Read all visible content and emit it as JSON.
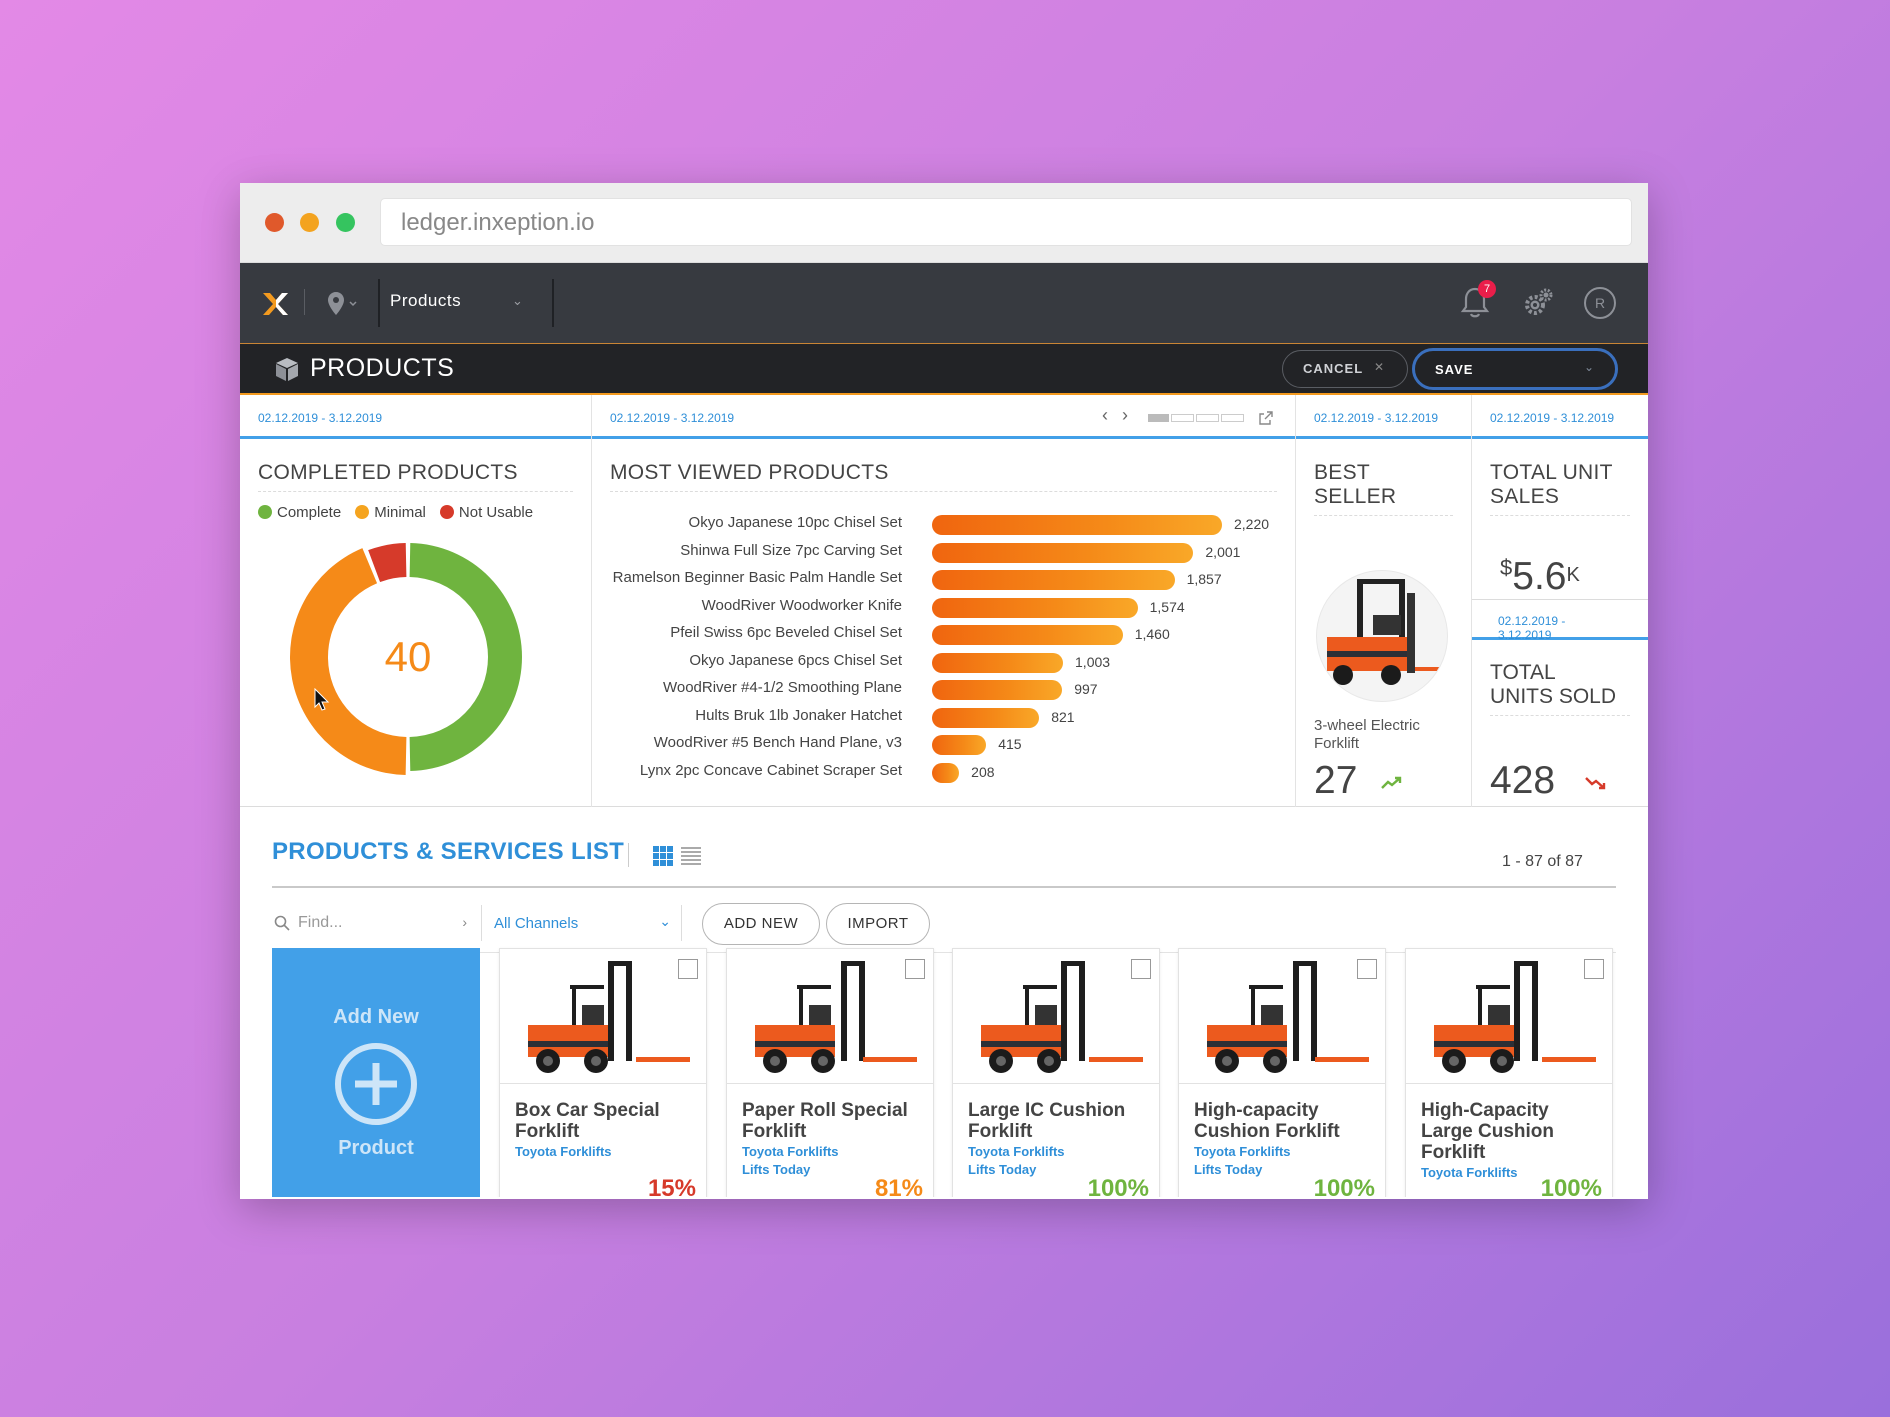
{
  "browser": {
    "url": "ledger.inxeption.io"
  },
  "nav": {
    "section": "Products",
    "notification_count": "7",
    "avatar_initial": "R"
  },
  "header": {
    "title": "PRODUCTS",
    "cancel_label": "CANCEL",
    "save_label": "SAVE"
  },
  "colors": {
    "accent_blue": "#2f8fd8",
    "orange": "#f58a18",
    "green": "#6fb43f",
    "red": "#d63a2a"
  },
  "completed": {
    "date_range": "02.12.2019 - 3.12.2019",
    "title": "COMPLETED PRODUCTS",
    "legend": [
      "Complete",
      "Minimal",
      "Not Usable"
    ],
    "center_value": "40"
  },
  "most_viewed": {
    "date_range": "02.12.2019 - 3.12.2019",
    "title": "MOST VIEWED PRODUCTS",
    "items": [
      {
        "label": "Okyo Japanese 10pc Chisel Set",
        "display": "2,220",
        "value": 2220
      },
      {
        "label": "Shinwa Full Size 7pc Carving Set",
        "display": "2,001",
        "value": 2001
      },
      {
        "label": "Ramelson Beginner Basic Palm Handle Set",
        "display": "1,857",
        "value": 1857
      },
      {
        "label": "WoodRiver Woodworker Knife",
        "display": "1,574",
        "value": 1574
      },
      {
        "label": "Pfeil Swiss 6pc Beveled Chisel Set",
        "display": "1,460",
        "value": 1460
      },
      {
        "label": "Okyo Japanese 6pcs Chisel Set",
        "display": "1,003",
        "value": 1003
      },
      {
        "label": "WoodRiver #4-1/2 Smoothing Plane",
        "display": "997",
        "value": 997
      },
      {
        "label": "Hults Bruk 1lb Jonaker Hatchet",
        "display": "821",
        "value": 821
      },
      {
        "label": "WoodRiver #5 Bench Hand Plane, v3",
        "display": "415",
        "value": 415
      },
      {
        "label": "Lynx 2pc Concave Cabinet Scraper Set",
        "display": "208",
        "value": 208
      }
    ]
  },
  "best_seller": {
    "date_range": "02.12.2019 - 3.12.2019",
    "title_line1": "BEST",
    "title_line2": "SELLER",
    "product": "3-wheel Electric Forklift",
    "value": "27"
  },
  "unit_sales": {
    "date_range": "02.12.2019 - 3.12.2019",
    "title_line1": "TOTAL UNIT",
    "title_line2": "SALES",
    "currency": "$",
    "value": "5.6",
    "suffix": "K"
  },
  "units_sold": {
    "date_range": "02.12.2019 - 3.12.2019",
    "title_line1": "TOTAL",
    "title_line2": "UNITS SOLD",
    "value": "428"
  },
  "list": {
    "title": "PRODUCTS & SERVICES LIST",
    "count": "1 - 87 of 87",
    "search_placeholder": "Find...",
    "channel": "All Channels",
    "add_new": "ADD NEW",
    "import": "IMPORT",
    "add_card_top": "Add New",
    "add_card_bottom": "Product"
  },
  "chart_data": [
    {
      "type": "pie",
      "title": "COMPLETED PRODUCTS",
      "categories": [
        "Complete",
        "Minimal",
        "Not Usable"
      ],
      "values": [
        50,
        44,
        6
      ],
      "center_label": "40"
    },
    {
      "type": "bar",
      "title": "MOST VIEWED PRODUCTS",
      "categories": [
        "Okyo Japanese 10pc Chisel Set",
        "Shinwa Full Size 7pc Carving Set",
        "Ramelson Beginner Basic Palm Handle Set",
        "WoodRiver Woodworker Knife",
        "Pfeil Swiss 6pc Beveled Chisel Set",
        "Okyo Japanese 6pcs Chisel Set",
        "WoodRiver #4-1/2 Smoothing Plane",
        "Hults Bruk 1lb Jonaker Hatchet",
        "WoodRiver #5 Bench Hand Plane, v3",
        "Lynx 2pc Concave Cabinet Scraper Set"
      ],
      "values": [
        2220,
        2001,
        1857,
        1574,
        1460,
        1003,
        997,
        821,
        415,
        208
      ]
    }
  ],
  "products": [
    {
      "name": "Box Car Special Forklift",
      "brand": "Toyota Forklifts",
      "tag": "",
      "pct": "15%",
      "pct_color": "#d63a2a"
    },
    {
      "name": "Paper Roll Special Forklift",
      "brand": "Toyota Forklifts",
      "tag": "Lifts Today",
      "pct": "81%",
      "pct_color": "#f58a18"
    },
    {
      "name": "Large IC Cushion Forklift",
      "brand": "Toyota Forklifts",
      "tag": "Lifts Today",
      "pct": "100%",
      "pct_color": "#6fb43f"
    },
    {
      "name": "High-capacity Cushion Forklift",
      "brand": "Toyota Forklifts",
      "tag": "Lifts Today",
      "pct": "100%",
      "pct_color": "#6fb43f"
    },
    {
      "name": "High-Capacity Large Cushion Forklift",
      "brand": "Toyota Forklifts",
      "tag": "",
      "pct": "100%",
      "pct_color": "#6fb43f"
    }
  ]
}
